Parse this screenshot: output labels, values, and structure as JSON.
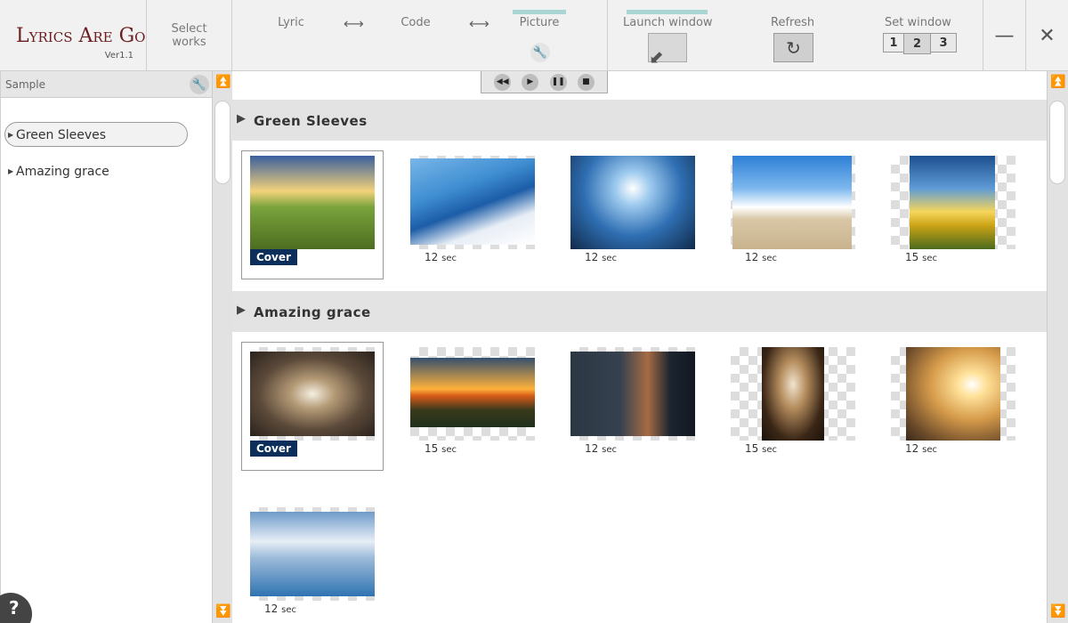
{
  "app": {
    "title": "Lyrics Are Go",
    "version": "Ver1.1"
  },
  "topbar": {
    "select_works": "Select works",
    "modes": {
      "lyric": "Lyric",
      "code": "Code",
      "picture": "Picture"
    },
    "arrow_glyph": "⟷",
    "launch_window": "Launch window",
    "refresh": "Refresh",
    "set_window": "Set window",
    "window_buttons": [
      "1",
      "2",
      "3"
    ],
    "minimize_glyph": "—",
    "close_glyph": "✕"
  },
  "sidebar": {
    "title": "Sample",
    "works": [
      "Green Sleeves",
      "Amazing grace"
    ],
    "help_glyph": "?"
  },
  "main": {
    "sections": [
      {
        "title": "Green Sleeves",
        "pictures": [
          {
            "cover": true,
            "cover_label": "Cover"
          },
          {
            "duration": "12",
            "unit": "sec"
          },
          {
            "duration": "12",
            "unit": "sec"
          },
          {
            "duration": "12",
            "unit": "sec"
          },
          {
            "duration": "15",
            "unit": "sec"
          }
        ]
      },
      {
        "title": "Amazing grace",
        "pictures": [
          {
            "cover": true,
            "cover_label": "Cover"
          },
          {
            "duration": "15",
            "unit": "sec"
          },
          {
            "duration": "12",
            "unit": "sec"
          },
          {
            "duration": "15",
            "unit": "sec"
          },
          {
            "duration": "12",
            "unit": "sec"
          },
          {
            "duration": "12",
            "unit": "sec"
          }
        ]
      }
    ]
  }
}
